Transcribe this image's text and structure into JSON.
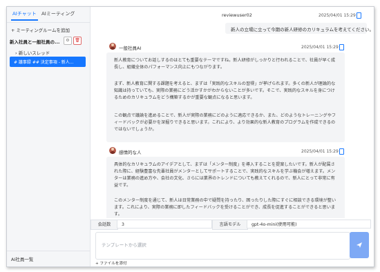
{
  "sidebar": {
    "tabs": [
      "AIチャット",
      "AIミーティング"
    ],
    "add_room": "ミーティングルームを追加",
    "room_name": "新入社員と一般社員の...",
    "new_thread": "新しいスレッド",
    "active_thread": "# 議事録 ## 決定事項 - 新人...",
    "footer": "AI社員一覧"
  },
  "chat": {
    "user_message": {
      "user": "reviewuser02",
      "time": "2025/04/01 15:29",
      "text": "新人の立場に立って今期の新人研修のカリキュラムを考えてください。"
    },
    "ai_messages": [
      {
        "name": "一般社員AI",
        "time": "2025/04/01 15:29",
        "paragraphs": [
          "新人教育についてお話しするのはとても重要なテーマですね。新人研修がしっかりと行われることで、社員が早く成長し、組織全体のパフォーマンス向上にもつながります。",
          "まず、新人教育に関する課題を考えると、まずは「実践的なスキルの習得」が挙げられます。多くの新人が理論的な知識は持っていても、実際の業務にどう活かすかがわからないことが多いです。そこで、実践的なスキルを身につけるためのカリキュラムをどう構築するかが重要な観点になると思います。",
          "この観点で議論を進めることで、新人が実際の業務にどのように適応できるか、また、どのようなトレーニングやフィードバックが必要かを深掘りできると思います。これにより、より効果的な新人教育のプログラムを作成できるのではないでしょうか。"
        ]
      },
      {
        "name": "感情的な人",
        "time": "2025/04/01 15:29",
        "paragraphs": [
          "具体的なカリキュラムのアイデアとして、まずは「メンター制度」を導入することを提案したいです。新人が配属された際に、経験豊富な先輩社員がメンターとしてサポートすることで、実践的なスキルを学ぶ機会が増えます。メンターは業務の進め方や、会社の文化、さらには業界のトレンドについても教えてくれるので、新人にとって非常に有益です。",
          "このメンター制度を通じて、新人は日常業務の中で疑問を持ったり、困ったりした際にすぐに相談できる環境が整います。これにより、実際の業務に即したフィードバックを受けることができ、成長を促進することができると思います。"
        ]
      }
    ]
  },
  "controls": {
    "count_label": "会話数",
    "count_value": "3",
    "model_label": "言語モデル",
    "model_value": "gpt-4o-mini(使用可能)",
    "input_placeholder": "テンプレートから選択",
    "attach_label": "ファイルを添付"
  },
  "colors": {
    "accent": "#1677ff",
    "send_button": "#7ea9f5",
    "bubble": "#f3f4f6",
    "sidebar_bg": "#f5f6f8",
    "delete": "#d33333"
  },
  "icons": {
    "copy": "copy-icon",
    "settings": "gear-icon",
    "delete": "trash-icon",
    "send": "send-icon",
    "chevron": "chevron-right-icon",
    "plus": "plus-icon"
  }
}
